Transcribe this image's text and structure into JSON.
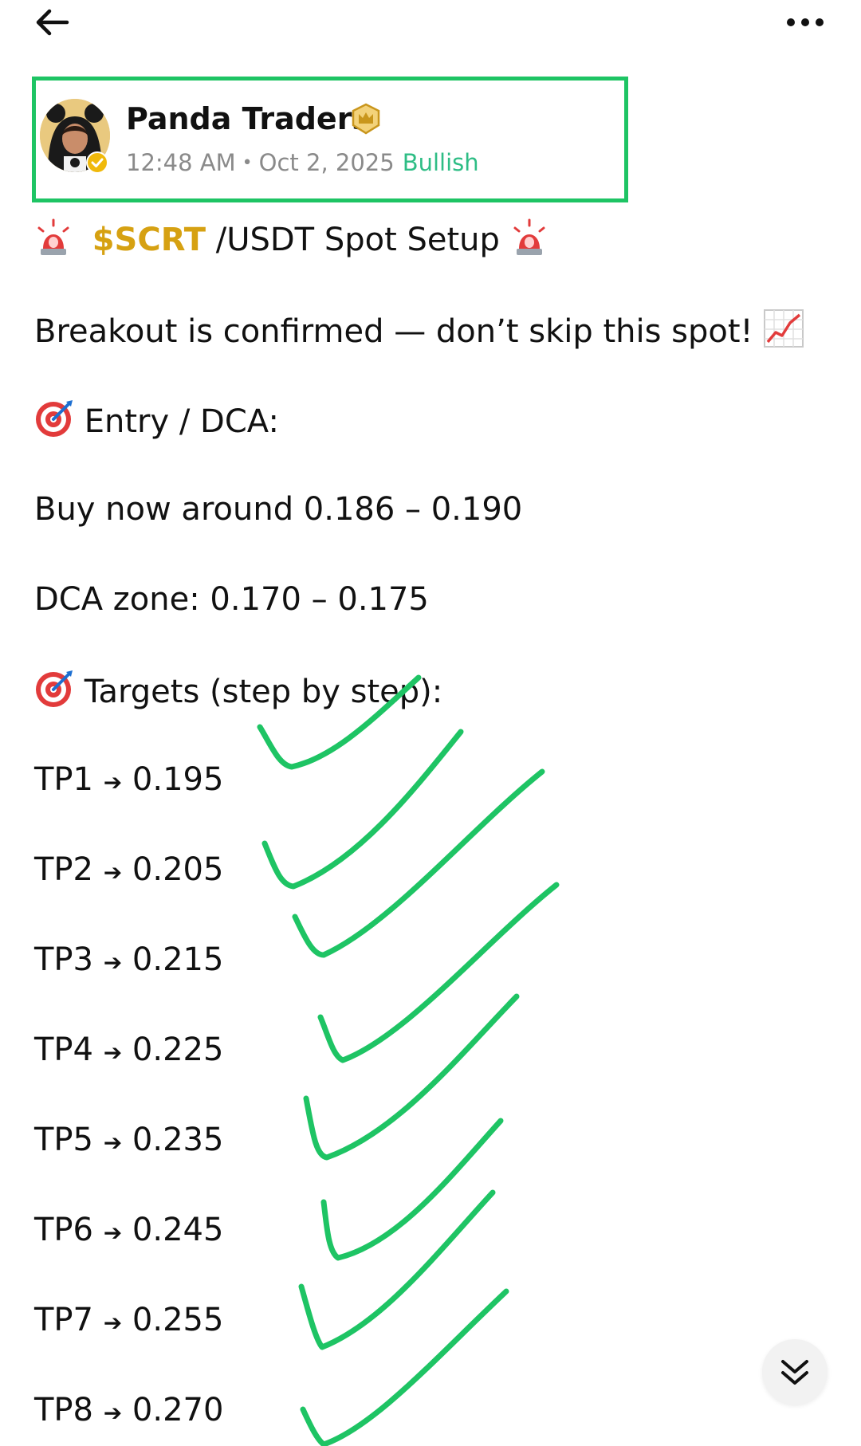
{
  "author": {
    "name": "Panda Traders",
    "time": "12:48 AM",
    "date": "Oct 2, 2025",
    "sentiment": "Bullish",
    "sentiment_color": "#2ebd85",
    "badge_icon": "crown-icon",
    "verified_icon": "verified-check-icon"
  },
  "post": {
    "title_ticker": "$SCRT",
    "title_rest": " /USDT Spot Setup ",
    "line_breakout": "Breakout is confirmed — don’t skip this spot! ",
    "entry_heading": " Entry / DCA:",
    "entry_buy": "Buy now around 0.186 – 0.190",
    "entry_dca": "DCA zone: 0.170 – 0.175",
    "targets_heading": " Targets (step by step):",
    "targets": [
      {
        "label": "TP1",
        "value": "0.195"
      },
      {
        "label": "TP2",
        "value": "0.205"
      },
      {
        "label": "TP3",
        "value": "0.215"
      },
      {
        "label": "TP4",
        "value": "0.225"
      },
      {
        "label": "TP5",
        "value": "0.235"
      },
      {
        "label": "TP6",
        "value": "0.245"
      },
      {
        "label": "TP7",
        "value": "0.255"
      },
      {
        "label": "TP8",
        "value": "0.270"
      }
    ]
  },
  "ui": {
    "back_icon": "arrow-left-icon",
    "more_icon": "more-dots-icon",
    "scroll_icon": "double-chevron-down-icon",
    "highlight_color": "#1ec464",
    "ticker_color": "#d6a112"
  }
}
